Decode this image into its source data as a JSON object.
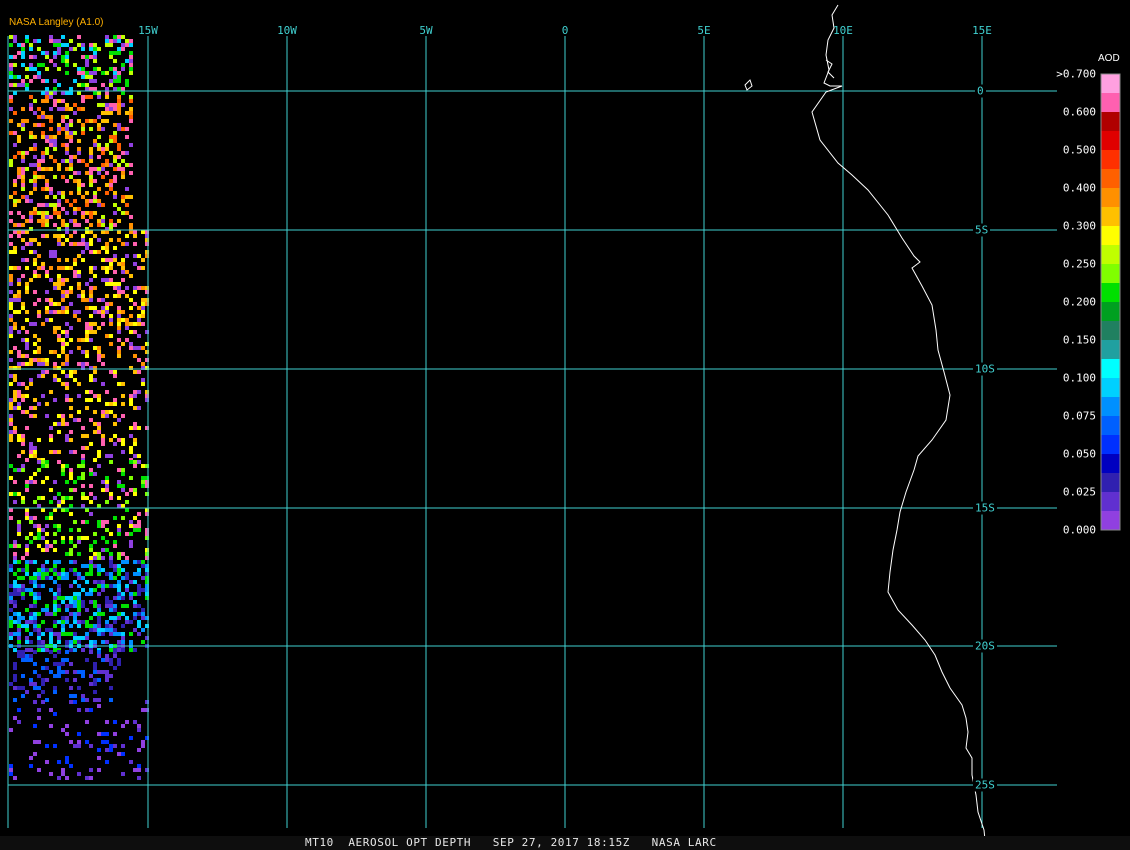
{
  "credit": "NASA Langley (A1.0)",
  "footer": "MT10  AEROSOL OPT DEPTH   SEP 27, 2017 18:15Z   NASA LARC",
  "longitude_labels": [
    "15W",
    "10W",
    "5W",
    "0",
    "5E",
    "10E",
    "15E"
  ],
  "latitude_labels": [
    "0",
    "5S",
    "10S",
    "15S",
    "20S",
    "25S"
  ],
  "legend": {
    "title": "AOD",
    "labels": [
      ">0.700",
      "0.600",
      "0.500",
      "0.400",
      "0.300",
      "0.250",
      "0.200",
      "0.150",
      "0.100",
      "0.075",
      "0.050",
      "0.025",
      "0.000"
    ],
    "colors": [
      "#ffa0e0",
      "#ff60b0",
      "#b00000",
      "#e00000",
      "#ff3000",
      "#ff6000",
      "#ff9000",
      "#ffc000",
      "#ffff00",
      "#c0ff00",
      "#80ff00",
      "#00e000",
      "#00a020",
      "#208060",
      "#20a0a0",
      "#00ffff",
      "#00d0ff",
      "#0090ff",
      "#0060ff",
      "#0030ff",
      "#0000c0",
      "#3020b0",
      "#6030d0",
      "#9040e0"
    ]
  },
  "colors": {
    "grid": "#40d0d0",
    "coast": "#ffffff",
    "background": "#000000"
  }
}
